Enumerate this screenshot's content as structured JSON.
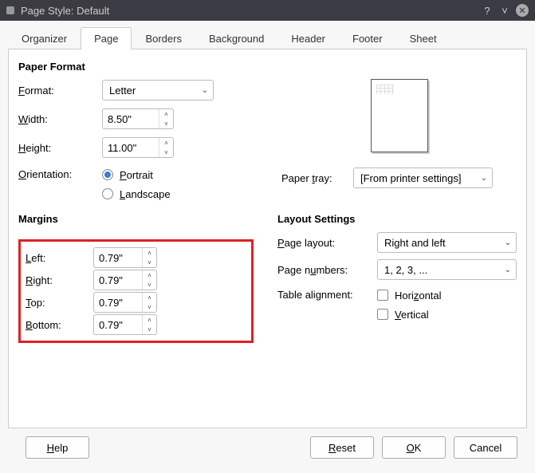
{
  "window": {
    "title": "Page Style: Default"
  },
  "tabs": [
    "Organizer",
    "Page",
    "Borders",
    "Background",
    "Header",
    "Footer",
    "Sheet"
  ],
  "activeTab": 1,
  "paperFormat": {
    "title": "Paper Format",
    "format": {
      "label": "Format:",
      "u": "F",
      "value": "Letter"
    },
    "width": {
      "label": "Width:",
      "u": "W",
      "value": "8.50\""
    },
    "height": {
      "label": "Height:",
      "u": "H",
      "value": "11.00\""
    },
    "orientation": {
      "label": "Orientation:",
      "u": "O",
      "portrait": {
        "label": "Portrait",
        "u": "P",
        "checked": true
      },
      "landscape": {
        "label": "Landscape",
        "u": "L",
        "checked": false
      }
    },
    "paperTray": {
      "label": "Paper tray:",
      "u": "t",
      "value": "[From printer settings]"
    }
  },
  "margins": {
    "title": "Margins",
    "left": {
      "label": "Left:",
      "u": "L",
      "value": "0.79\""
    },
    "right": {
      "label": "Right:",
      "u": "R",
      "value": "0.79\""
    },
    "top": {
      "label": "Top:",
      "u": "T",
      "value": "0.79\""
    },
    "bottom": {
      "label": "Bottom:",
      "u": "B",
      "value": "0.79\""
    }
  },
  "layout": {
    "title": "Layout Settings",
    "pageLayout": {
      "label": "Page layout:",
      "u": "P",
      "value": "Right and left"
    },
    "pageNumbers": {
      "label": "Page numbers:",
      "u": "u",
      "value": "1, 2, 3, ..."
    },
    "tableAlign": {
      "label": "Table alignment:",
      "horizontal": {
        "label": "Horizontal",
        "u": "z",
        "checked": false
      },
      "vertical": {
        "label": "Vertical",
        "u": "V",
        "checked": false
      }
    }
  },
  "buttons": {
    "help": {
      "label": "Help",
      "u": "H"
    },
    "reset": {
      "label": "Reset",
      "u": "R"
    },
    "ok": {
      "label": "OK",
      "u": "O"
    },
    "cancel": {
      "label": "Cancel"
    }
  }
}
